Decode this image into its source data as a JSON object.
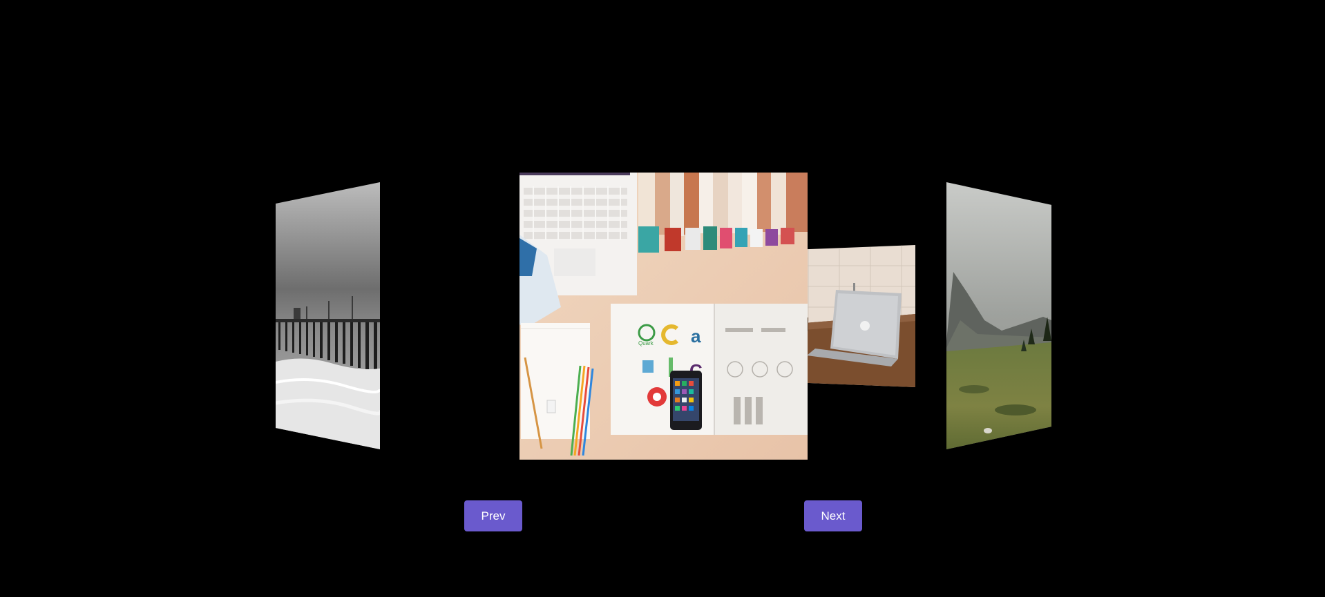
{
  "carousel": {
    "prev_label": "Prev",
    "next_label": "Next",
    "accent_color": "#6a5acd",
    "background_color": "#000000",
    "slides": [
      {
        "name": "pier-photo",
        "subject": "black-and-white pier over the sea"
      },
      {
        "name": "desk-flatlay-photo",
        "subject": "desk with laptop, books, notebook and phone",
        "active": true
      },
      {
        "name": "laptop-photo",
        "subject": "laptop on wooden desk"
      },
      {
        "name": "mountain-landscape-photo",
        "subject": "green valley with mountains"
      }
    ],
    "desk_logos": [
      "Quark",
      "a",
      "C"
    ]
  }
}
